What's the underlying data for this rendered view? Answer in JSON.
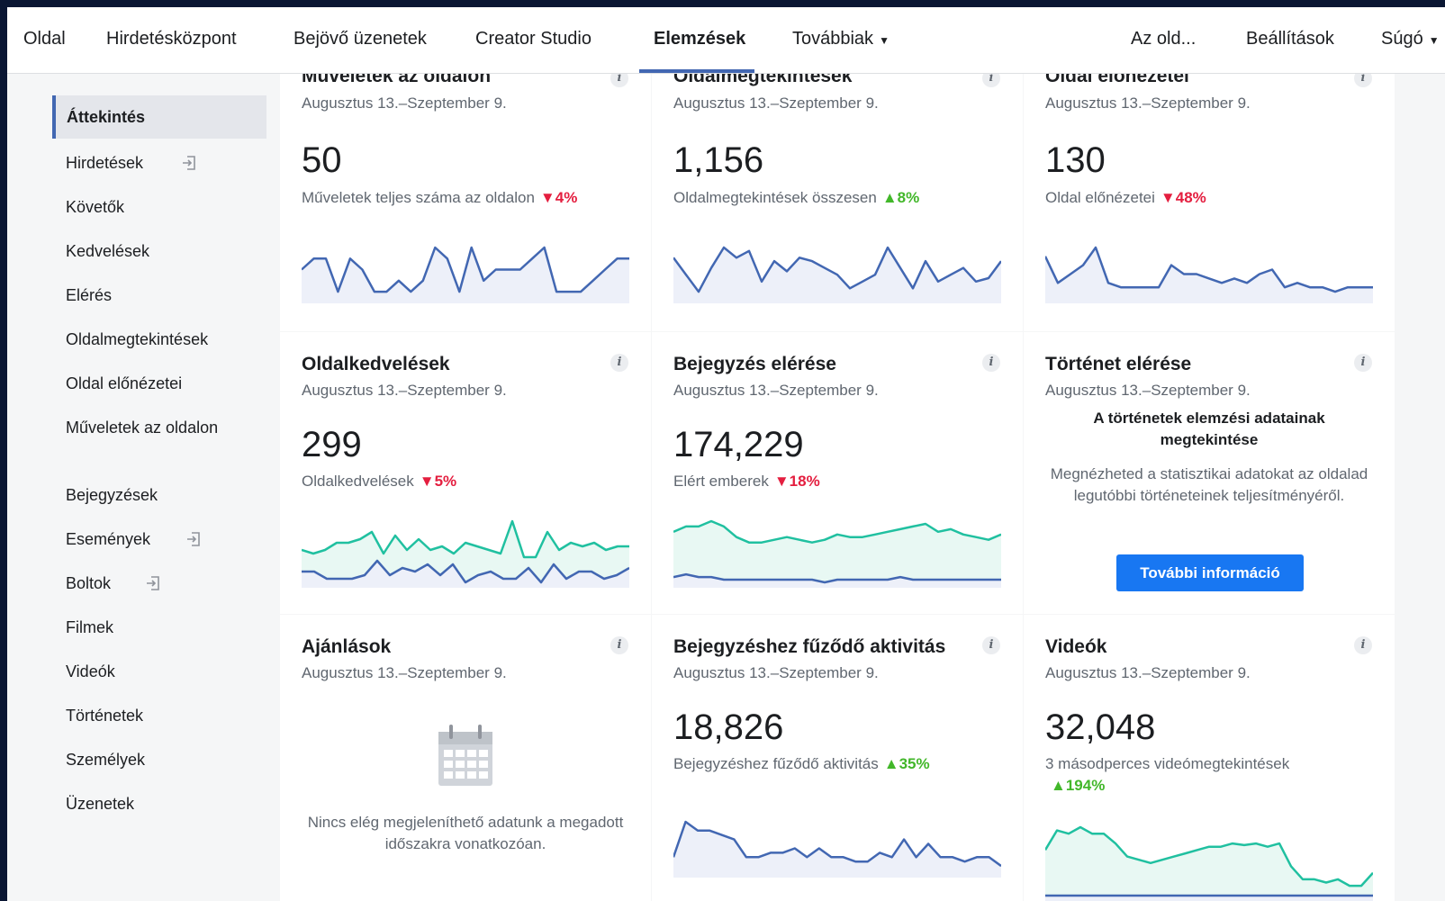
{
  "nav": {
    "items": [
      "Oldal",
      "Hirdetésközpont",
      "Bejövő üzenetek",
      "Creator Studio",
      "Elemzések",
      "Továbbiak"
    ],
    "right": [
      "Az old...",
      "Beállítások",
      "Súgó"
    ]
  },
  "sidebar": {
    "items": [
      "Áttekintés",
      "Hirdetések",
      "Követők",
      "Kedvelések",
      "Elérés",
      "Oldalmegtekintések",
      "Oldal előnézetei",
      "Műveletek az oldalon",
      "Bejegyzések",
      "Események",
      "Boltok",
      "Filmek",
      "Videók",
      "Történetek",
      "Személyek",
      "Üzenetek"
    ]
  },
  "colors": {
    "accent": "#4267b2",
    "green_line": "#20c0a0",
    "down": "#e41e3f",
    "up": "#42b72a",
    "button": "#1877f2"
  },
  "cards": [
    {
      "title": "Műveletek az oldalon",
      "date": "Augusztus 13.–Szeptember 9.",
      "value": "50",
      "sub": "Műveletek teljes száma az oldalon",
      "change": "4%",
      "dir": "down",
      "trend": [
        2,
        3,
        3,
        0,
        3,
        2,
        0,
        0,
        1,
        0,
        1,
        4,
        3,
        0,
        4,
        1,
        2,
        2,
        2,
        3,
        4,
        0,
        0,
        0,
        1,
        2,
        3,
        3
      ]
    },
    {
      "title": "Oldalmegtekintések",
      "date": "Augusztus 13.–Szeptember 9.",
      "value": "1,156",
      "sub": "Oldalmegtekintések összesen",
      "change": "8%",
      "dir": "up",
      "trend": [
        45,
        40,
        35,
        42,
        48,
        45,
        47,
        38,
        44,
        41,
        45,
        44,
        42,
        40,
        36,
        38,
        40,
        48,
        42,
        36,
        44,
        38,
        40,
        42,
        38,
        39,
        44
      ]
    },
    {
      "title": "Oldal előnézetei",
      "date": "Augusztus 13.–Szeptember 9.",
      "value": "130",
      "sub": "Oldal előnézetei",
      "change": "48%",
      "dir": "down",
      "trend": [
        10,
        4,
        6,
        8,
        12,
        4,
        3,
        3,
        3,
        3,
        8,
        6,
        6,
        5,
        4,
        5,
        4,
        6,
        7,
        3,
        4,
        3,
        3,
        2,
        3,
        3,
        3
      ]
    },
    {
      "title": "Oldalkedvelések",
      "date": "Augusztus 13.–Szeptember 9.",
      "value": "299",
      "sub": "Oldalkedvelések",
      "change": "5%",
      "dir": "down",
      "trend_a": [
        14,
        13,
        14,
        16,
        16,
        17,
        19,
        13,
        18,
        14,
        17,
        14,
        15,
        13,
        16,
        15,
        14,
        13,
        22,
        12,
        12,
        19,
        14,
        16,
        15,
        16,
        14,
        15,
        15
      ],
      "trend_b": [
        8,
        8,
        6,
        6,
        6,
        7,
        11,
        7,
        9,
        8,
        10,
        7,
        10,
        5,
        7,
        8,
        6,
        6,
        9,
        5,
        10,
        6,
        8,
        8,
        6,
        7,
        9
      ]
    },
    {
      "title": "Bejegyzés elérése",
      "date": "Augusztus 13.–Szeptember 9.",
      "value": "174,229",
      "sub": "Elért emberek",
      "change": "18%",
      "dir": "down",
      "trend_a": [
        22,
        24,
        24,
        26,
        24,
        20,
        18,
        18,
        19,
        20,
        19,
        18,
        19,
        21,
        20,
        20,
        21,
        22,
        23,
        24,
        25,
        22,
        23,
        21,
        20,
        19,
        21
      ],
      "trend_b": [
        5,
        6,
        5,
        5,
        4,
        4,
        4,
        4,
        4,
        4,
        4,
        4,
        3,
        4,
        4,
        4,
        4,
        4,
        5,
        4,
        4,
        4,
        4,
        4,
        4,
        4,
        4
      ]
    },
    {
      "title": "Történet elérése",
      "date": "Augusztus 13.–Szeptember 9.",
      "story_head": "A történetek elemzési adatainak megtekintése",
      "story_text": "Megnézheted a statisztikai adatokat az oldalad legutóbbi történeteinek teljesítményéről.",
      "button": "További információ"
    },
    {
      "title": "Ajánlások",
      "date": "Augusztus 13.–Szeptember 9.",
      "empty": "Nincs elég megjeleníthető adatunk a megadott időszakra vonatkozóan."
    },
    {
      "title": "Bejegyzéshez fűződő aktivitás",
      "date": "Augusztus 13.–Szeptember 9.",
      "value": "18,826",
      "sub": "Bejegyzéshez fűződő aktivitás",
      "change": "35%",
      "dir": "up",
      "trend": [
        20,
        28,
        26,
        26,
        25,
        24,
        20,
        20,
        21,
        21,
        22,
        20,
        22,
        20,
        20,
        19,
        19,
        21,
        20,
        24,
        20,
        23,
        20,
        20,
        19,
        20,
        20,
        18
      ]
    },
    {
      "title": "Videók",
      "date": "Augusztus 13.–Szeptember 9.",
      "value": "32,048",
      "sub": "3 másodperces videómegtekintések",
      "change": "194%",
      "dir": "up",
      "trend_a": [
        30,
        42,
        40,
        44,
        40,
        40,
        34,
        26,
        24,
        22,
        24,
        26,
        28,
        30,
        32,
        32,
        34,
        33,
        34,
        32,
        34,
        20,
        12,
        12,
        10,
        12,
        8,
        8,
        16
      ],
      "trend_b": [
        2,
        2,
        2,
        2,
        2,
        2,
        2,
        2,
        2,
        2,
        2,
        2,
        2,
        2,
        2,
        2,
        2,
        2,
        2,
        2,
        2,
        2,
        2,
        2,
        2,
        2,
        2,
        2,
        2
      ]
    }
  ]
}
